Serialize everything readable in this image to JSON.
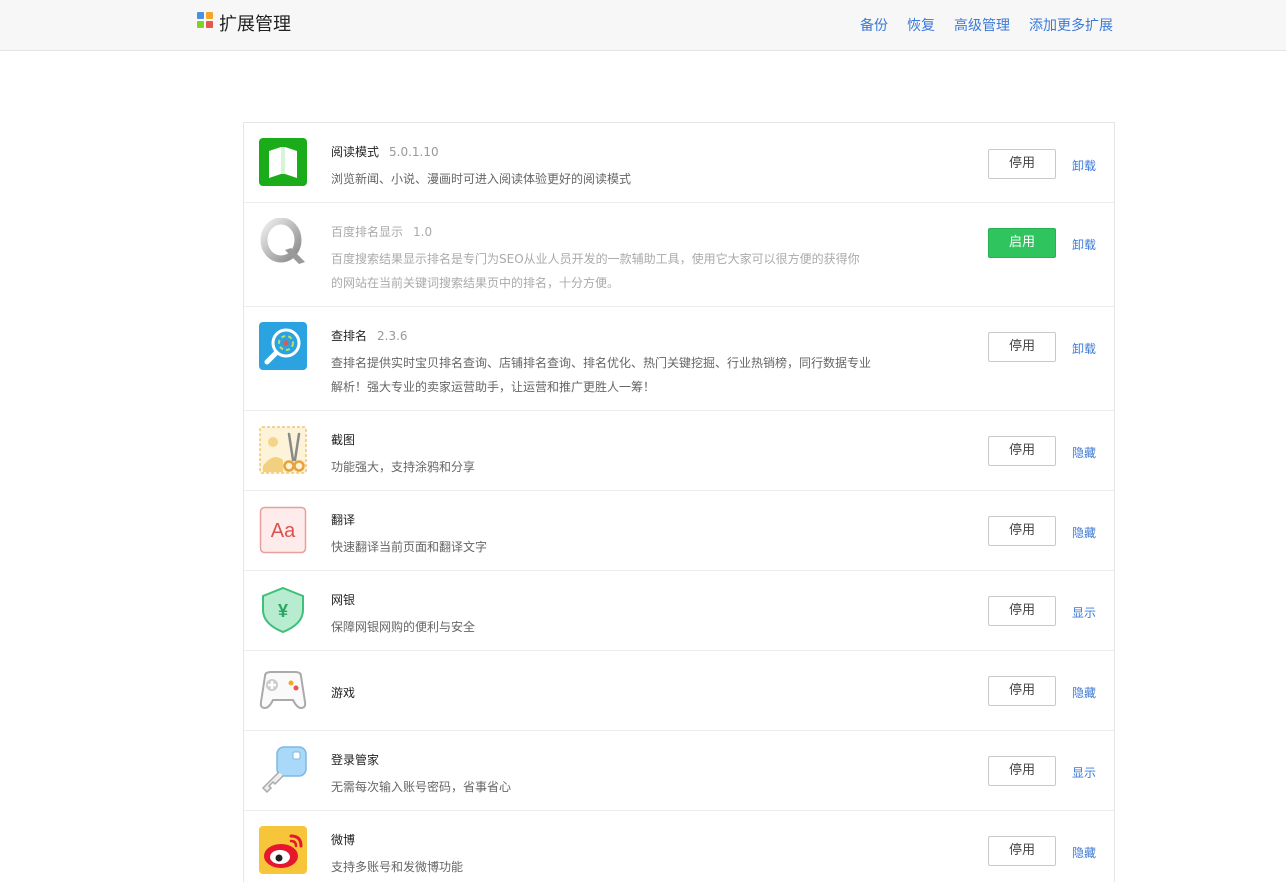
{
  "header": {
    "title": "扩展管理",
    "nav": [
      "备份",
      "恢复",
      "高级管理",
      "添加更多扩展"
    ]
  },
  "extensions": [
    {
      "name": "阅读模式",
      "version": "5.0.1.10",
      "desc": "浏览新闻、小说、漫画时可进入阅读体验更好的阅读模式",
      "button": "停用",
      "action": "卸载",
      "enabled": true,
      "icon": "book-icon"
    },
    {
      "name": "百度排名显示",
      "version": "1.0",
      "desc": "百度搜索结果显示排名是专门为SEO从业人员开发的一款辅助工具，使用它大家可以很方便的获得你的网站在当前关键词搜索结果页中的排名，十分方便。",
      "button": "启用",
      "action": "卸载",
      "enabled": false,
      "icon": "q-letter-icon"
    },
    {
      "name": "查排名",
      "version": "2.3.6",
      "desc": "查排名提供实时宝贝排名查询、店铺排名查询、排名优化、热门关键挖掘、行业热销榜，同行数据专业解析！强大专业的卖家运营助手，让运营和推广更胜人一筹！",
      "button": "停用",
      "action": "卸载",
      "enabled": true,
      "icon": "magnifier-target-icon"
    },
    {
      "name": "截图",
      "version": "",
      "desc": "功能强大，支持涂鸦和分享",
      "button": "停用",
      "action": "隐藏",
      "enabled": true,
      "icon": "scissors-icon"
    },
    {
      "name": "翻译",
      "version": "",
      "desc": "快速翻译当前页面和翻译文字",
      "button": "停用",
      "action": "隐藏",
      "enabled": true,
      "icon": "translate-aa-icon"
    },
    {
      "name": "网银",
      "version": "",
      "desc": "保障网银网购的便利与安全",
      "button": "停用",
      "action": "显示",
      "enabled": true,
      "icon": "shield-yuan-icon"
    },
    {
      "name": "游戏",
      "version": "",
      "desc": "",
      "button": "停用",
      "action": "隐藏",
      "enabled": true,
      "icon": "gamepad-icon"
    },
    {
      "name": "登录管家",
      "version": "",
      "desc": "无需每次输入账号密码，省事省心",
      "button": "停用",
      "action": "显示",
      "enabled": true,
      "icon": "key-icon"
    },
    {
      "name": "微博",
      "version": "",
      "desc": "支持多账号和发微博功能",
      "button": "停用",
      "action": "隐藏",
      "enabled": true,
      "icon": "weibo-icon"
    }
  ]
}
